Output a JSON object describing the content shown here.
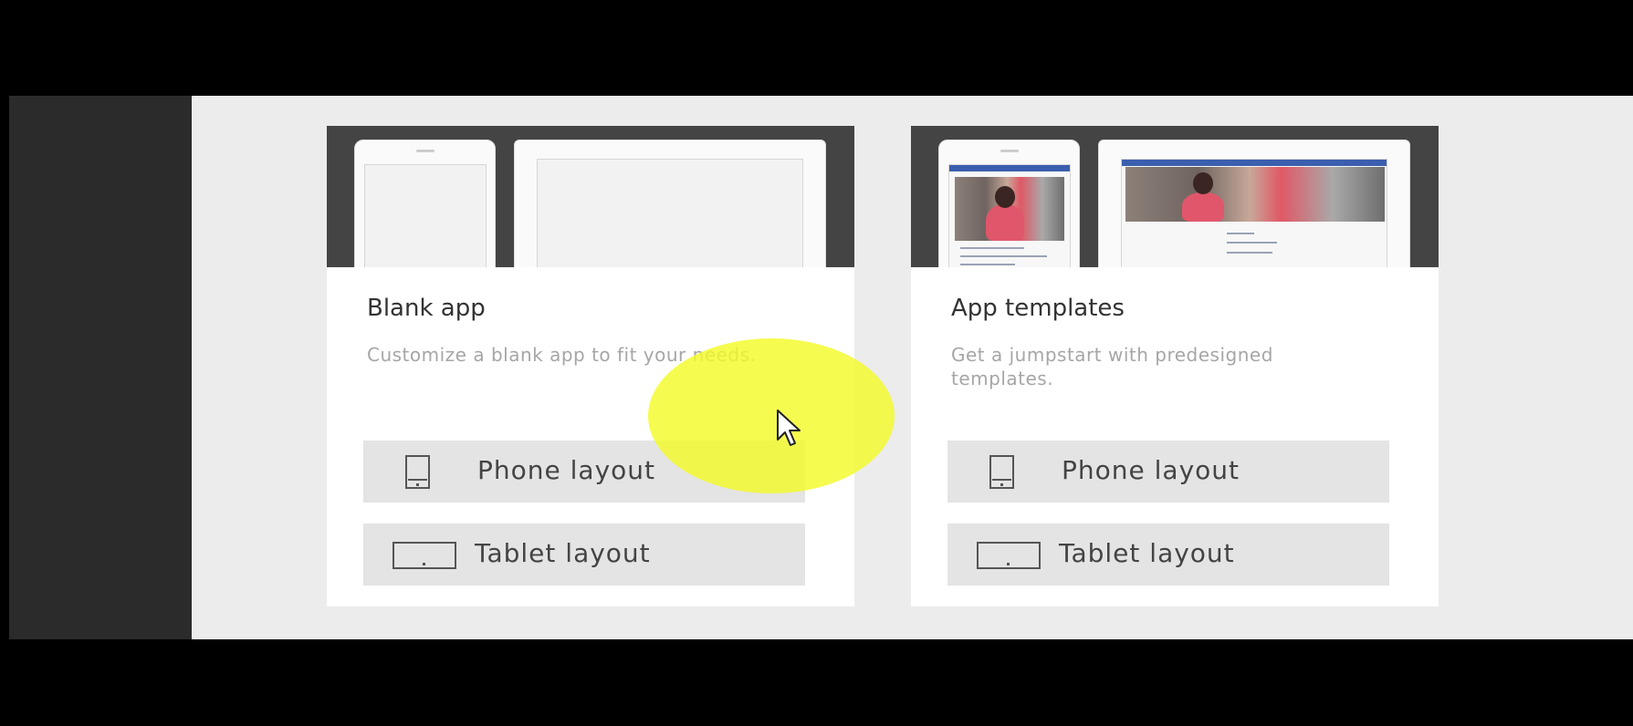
{
  "colors": {
    "background": "#000000",
    "left_panel": "#2b2b2b",
    "main_area": "#ececec",
    "card": "#ffffff",
    "button": "#e4e4e4",
    "highlight": "#f4fa28",
    "template_accent": "#3b5fae"
  },
  "cards": [
    {
      "title": "Blank app",
      "description": "Customize a blank app to fit your needs.",
      "buttons": [
        {
          "label": "Phone layout",
          "icon": "phone-icon"
        },
        {
          "label": "Tablet layout",
          "icon": "tablet-icon"
        }
      ]
    },
    {
      "title": "App templates",
      "description": "Get a jumpstart with predesigned templates.",
      "buttons": [
        {
          "label": "Phone layout",
          "icon": "phone-icon"
        },
        {
          "label": "Tablet layout",
          "icon": "tablet-icon"
        }
      ]
    }
  ],
  "cursor": {
    "icon": "mouse-pointer-icon",
    "highlight": "click-highlight"
  }
}
